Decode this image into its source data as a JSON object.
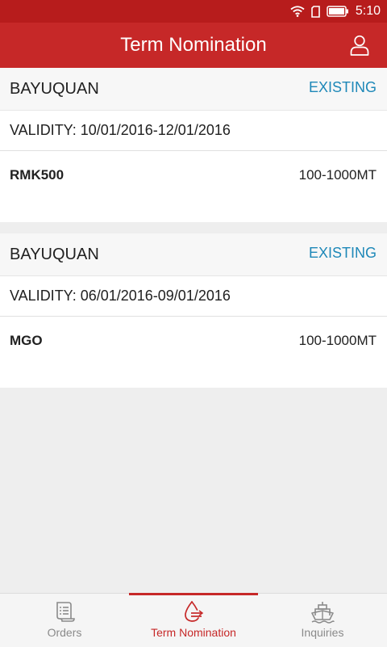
{
  "status_bar": {
    "time": "5:10"
  },
  "app_bar": {
    "title": "Term Nomination"
  },
  "nominations": [
    {
      "port": "BAYUQUAN",
      "status": "EXISTING",
      "validity": "VALIDITY: 10/01/2016-12/01/2016",
      "product": "RMK500",
      "quantity": "100-1000MT"
    },
    {
      "port": "BAYUQUAN",
      "status": "EXISTING",
      "validity": "VALIDITY: 06/01/2016-09/01/2016",
      "product": "MGO",
      "quantity": "100-1000MT"
    }
  ],
  "bottom_nav": {
    "items": [
      {
        "label": "Orders",
        "icon": "orders-list-icon"
      },
      {
        "label": "Term Nomination",
        "icon": "fuel-drop-icon"
      },
      {
        "label": "Inquiries",
        "icon": "ship-icon"
      }
    ]
  },
  "colors": {
    "primary": "#c62828",
    "status_bar": "#b71c1c",
    "status_text": "#1e88b8",
    "inactive": "#8a8a8a"
  }
}
